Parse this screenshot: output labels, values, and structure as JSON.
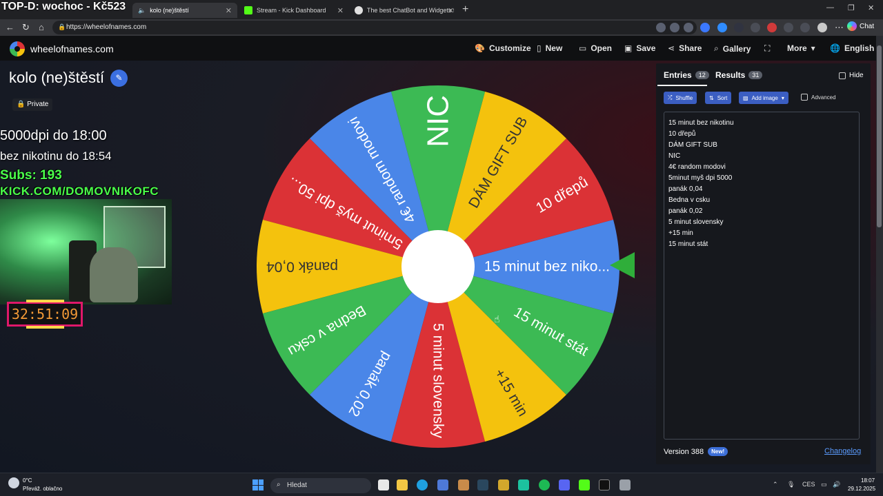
{
  "overlay": {
    "stream_title": "TOP-D: wochoc - Kč523",
    "countdown_1": "5000dpi do 18:00",
    "countdown_2": "bez nikotinu do 18:54",
    "subs": "Subs: 193",
    "channel": "KICK.COM/DOMOVNIKOFC",
    "timer": "32:51:09"
  },
  "browser": {
    "tabs": [
      {
        "label": "kolo (ne)štěstí",
        "active": true
      },
      {
        "label": "Stream - Kick Dashboard",
        "active": false
      },
      {
        "label": "The best ChatBot and Widgets for",
        "active": false
      }
    ],
    "url": "https://wheelofnames.com",
    "chat_label": "Chat"
  },
  "site": {
    "name": "wheelofnames.com",
    "menu": [
      "Customize",
      "New",
      "Open",
      "Save",
      "Share",
      "Gallery",
      "More",
      "English"
    ]
  },
  "wheel": {
    "title": "kolo (ne)štěstí",
    "visibility": "Private",
    "segments": [
      {
        "label": "15 minut bez niko...",
        "color": "#4a86e8"
      },
      {
        "label": "10 dřepů",
        "color": "#db3236"
      },
      {
        "label": "DÁM GIFT SUB",
        "color": "#f4c20d"
      },
      {
        "label": "NIC",
        "color": "#3cba54"
      },
      {
        "label": "4€ random modovi",
        "color": "#4a86e8"
      },
      {
        "label": "5minut myš dpi 50...",
        "color": "#db3236"
      },
      {
        "label": "panák 0,04",
        "color": "#f4c20d"
      },
      {
        "label": "Bedna v csku",
        "color": "#3cba54"
      },
      {
        "label": "panák 0,02",
        "color": "#4a86e8"
      },
      {
        "label": "5 minut slovensky",
        "color": "#db3236"
      },
      {
        "label": "+15 min",
        "color": "#f4c20d"
      },
      {
        "label": "15 minut stát",
        "color": "#3cba54"
      }
    ]
  },
  "panel": {
    "entries_tab": "Entries",
    "entries_count": "12",
    "results_tab": "Results",
    "results_count": "31",
    "hide_label": "Hide",
    "shuffle": "Shuffle",
    "sort": "Sort",
    "add_image": "Add image",
    "advanced": "Advanced",
    "entries": [
      "15 minut bez nikotinu",
      "10 dřepů",
      "DÁM GIFT SUB",
      "NIC",
      "4€ random modovi",
      "5minut myš dpi 5000",
      "panák 0,04",
      "Bedna v csku",
      "panák 0,02",
      "5 minut slovensky",
      "+15 min",
      "15 minut stát"
    ],
    "version": "Version 388",
    "new_badge": "New!",
    "changelog": "Changelog"
  },
  "taskbar": {
    "temperature": "0°C",
    "weather": "Převáž. oblačno",
    "search": "Hledat",
    "language": "CES",
    "time": "18:07",
    "date": "29.12.2025"
  }
}
